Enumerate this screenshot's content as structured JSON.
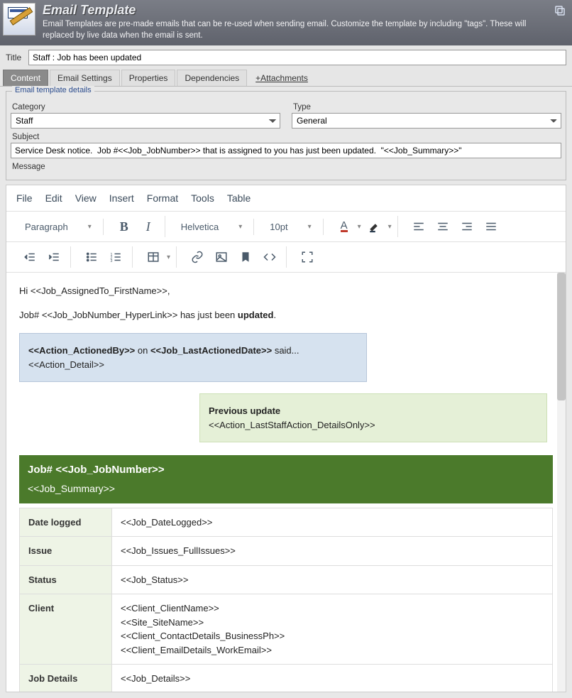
{
  "header": {
    "title": "Email Template",
    "description": "Email Templates are pre-made emails that can be re-used when sending email.  Customize the template by including \"tags\".  These will replaced by live data when the email is sent.",
    "copy_icon": "copy-icon"
  },
  "title_row": {
    "label": "Title",
    "value": "Staff : Job has been updated"
  },
  "tabs": {
    "content": "Content",
    "email_settings": "Email Settings",
    "properties": "Properties",
    "dependencies": "Dependencies",
    "attachments": "+Attachments"
  },
  "panel": {
    "title": "Email template details",
    "category_label": "Category",
    "category_value": "Staff",
    "type_label": "Type",
    "type_value": "General",
    "subject_label": "Subject",
    "subject_value": "Service Desk notice.  Job #<<Job_JobNumber>> that is assigned to you has just been updated.  \"<<Job_Summary>>\"",
    "message_label": "Message"
  },
  "menubar": [
    "File",
    "Edit",
    "View",
    "Insert",
    "Format",
    "Tools",
    "Table"
  ],
  "toolbar": {
    "para": "Paragraph",
    "font": "Helvetica",
    "size": "10pt"
  },
  "body": {
    "greeting_prefix": "Hi ",
    "greeting_tag": "<<Job_AssignedTo_FirstName>>",
    "greeting_suffix": ",",
    "line2_prefix": "Job# ",
    "line2_tag": "<<Job_JobNumber_HyperLink>>",
    "line2_mid": " has just been ",
    "line2_bold": "updated",
    "line2_end": ".",
    "blue_actioner": "<<Action_ActionedBy>>",
    "blue_on": " on ",
    "blue_date": "<<Job_LastActionedDate>>",
    "blue_said": " said...",
    "blue_detail": "<<Action_Detail>>",
    "green_title": "Previous update",
    "green_detail": "<<Action_LastStaffAction_DetailsOnly>>",
    "job_header_prefix": "Job# ",
    "job_header_num": "<<Job_JobNumber>>",
    "job_header_summary": "<<Job_Summary>>",
    "rows": [
      {
        "label": "Date logged",
        "value": "<<Job_DateLogged>>"
      },
      {
        "label": "Issue",
        "value": "<<Job_Issues_FullIssues>>"
      },
      {
        "label": "Status",
        "value": "<<Job_Status>>"
      },
      {
        "label": "Client",
        "value": "<<Client_ClientName>>\n<<Site_SiteName>>\n<<Client_ContactDetails_BusinessPh>>\n<<Client_EmailDetails_WorkEmail>>"
      },
      {
        "label": "Job Details",
        "value": "<<Job_Details>>"
      }
    ]
  }
}
